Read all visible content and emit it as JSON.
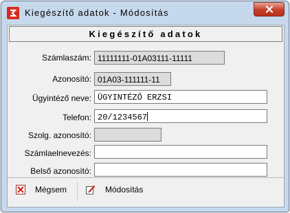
{
  "window": {
    "title": "Kiegészítő adatok - Módosítás",
    "app_icon": "app-logo-icon"
  },
  "form": {
    "header": "Kiegészítő adatok",
    "fields": [
      {
        "label": "Számlaszám:",
        "value": "11111111-01A03111-11111",
        "readonly": true
      },
      {
        "label": "Azonosító:",
        "value": "01A03-111111-11",
        "readonly": true
      },
      {
        "label": "Ügyintéző neve:",
        "value": "ÜGYINTÉZŐ ERZSI",
        "readonly": false
      },
      {
        "label": "Telefon:",
        "value": "20/1234567",
        "readonly": false
      },
      {
        "label": "Szolg. azonosító:",
        "value": "",
        "readonly": true
      },
      {
        "label": "Számlaelnevezés:",
        "value": "",
        "readonly": false
      },
      {
        "label": "Belső azonosító:",
        "value": "",
        "readonly": false
      }
    ]
  },
  "footer": {
    "cancel_label": "Mégsem",
    "modify_label": "Módosítás"
  },
  "colors": {
    "frame": "#c6d8ec",
    "close": "#c7402a",
    "readonly_bg": "#dcdcdc"
  }
}
